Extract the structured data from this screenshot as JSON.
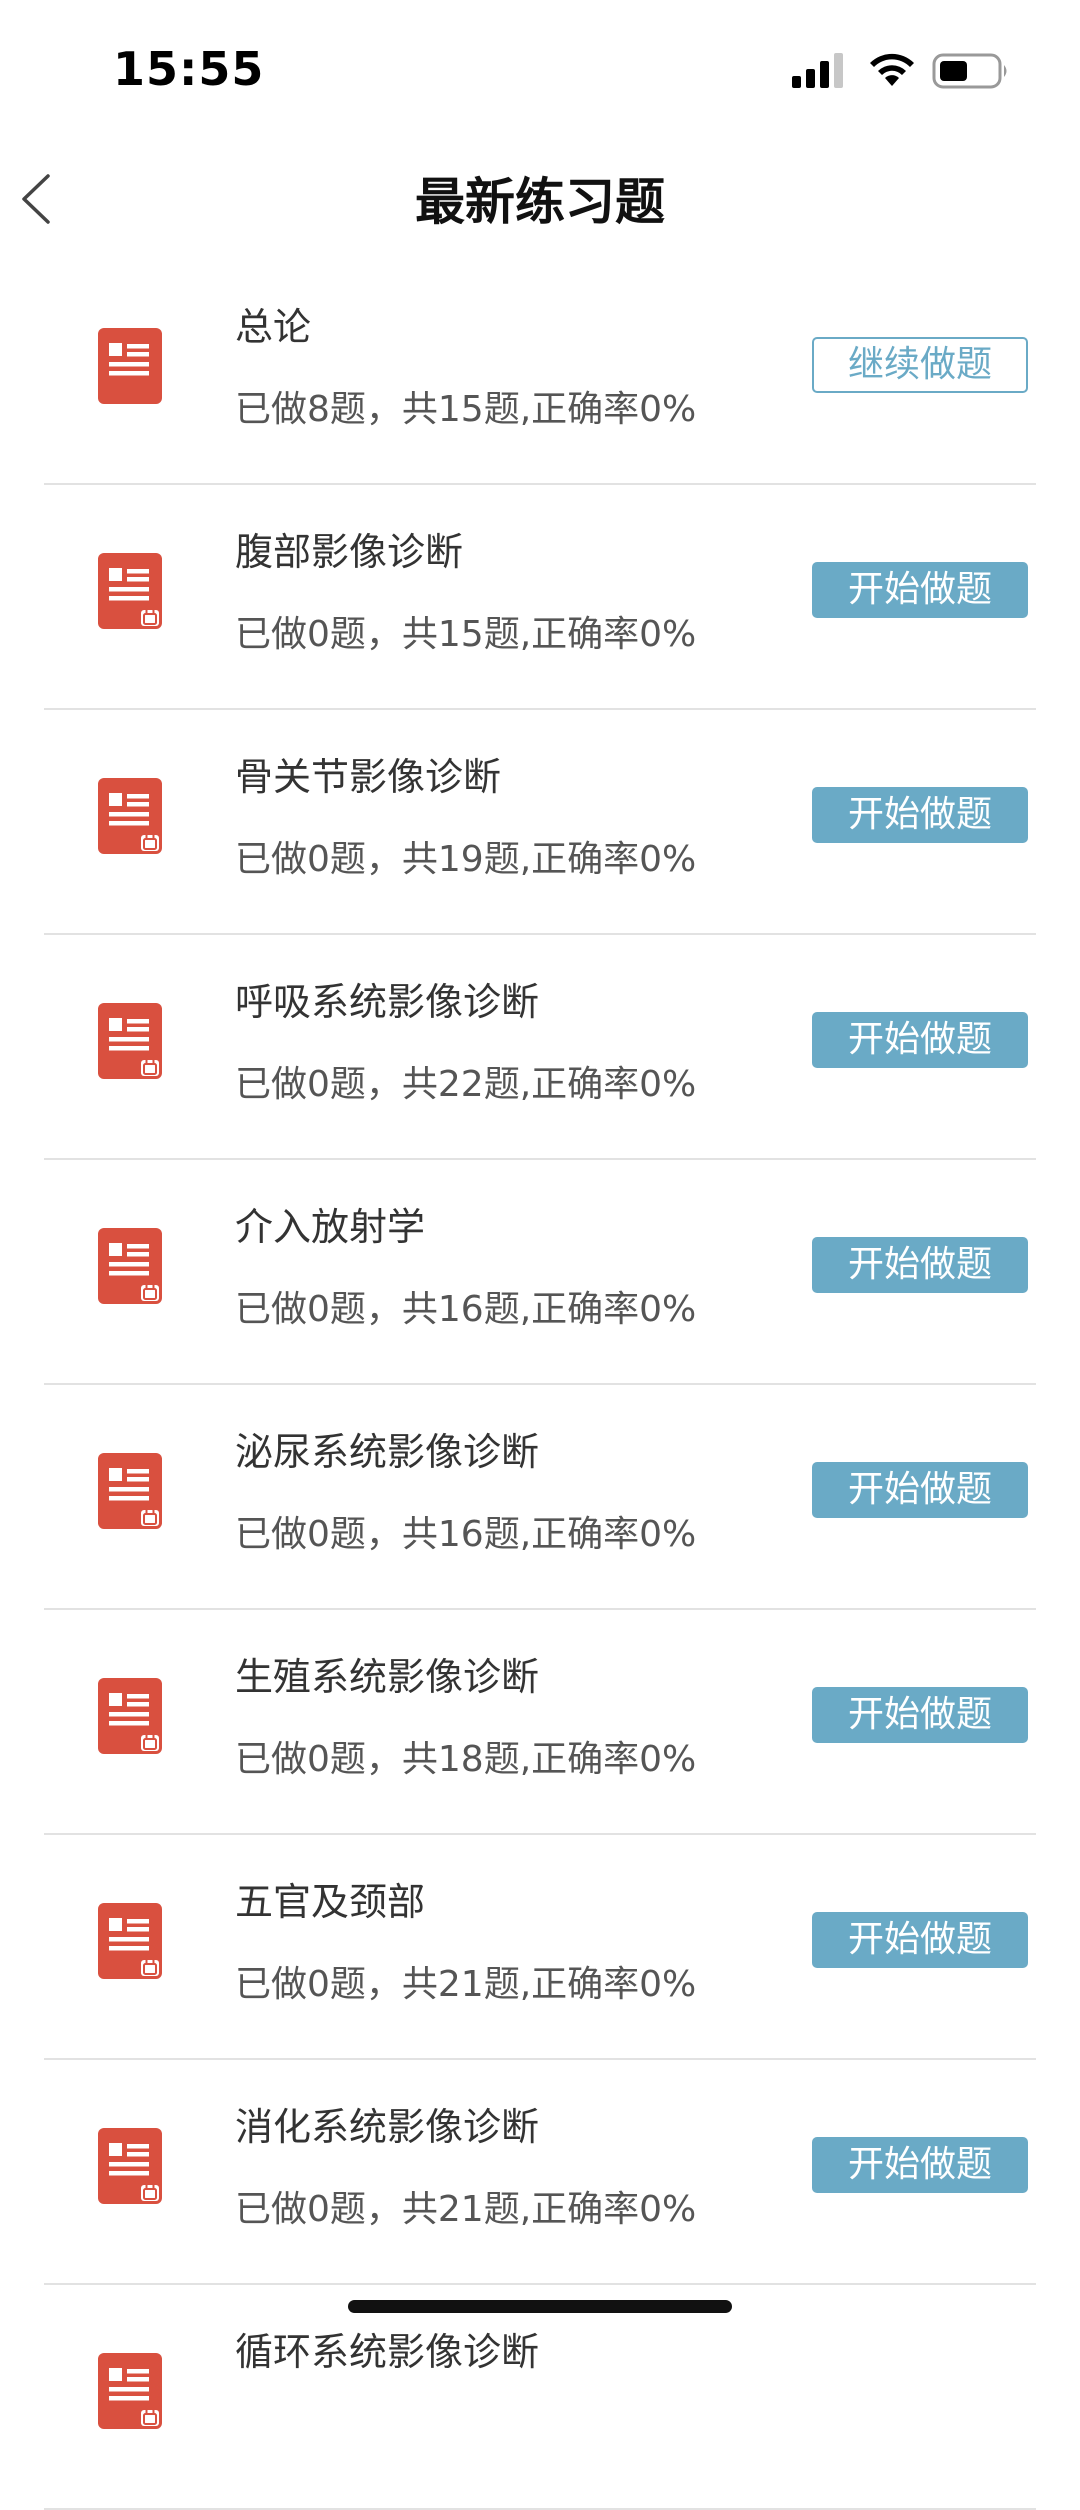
{
  "status_bar": {
    "time": "15:55"
  },
  "header": {
    "title": "最新练习题"
  },
  "colors": {
    "accent": "#6aaac6",
    "icon_red": "#d9503f"
  },
  "items": [
    {
      "title": "总论",
      "meta": "已做8题，共15题,正确率0%",
      "action": "继续做题",
      "action_style": "outline",
      "locked": false
    },
    {
      "title": "腹部影像诊断",
      "meta": "已做0题，共15题,正确率0%",
      "action": "开始做题",
      "action_style": "filled",
      "locked": true
    },
    {
      "title": "骨关节影像诊断",
      "meta": "已做0题，共19题,正确率0%",
      "action": "开始做题",
      "action_style": "filled",
      "locked": true
    },
    {
      "title": "呼吸系统影像诊断",
      "meta": "已做0题，共22题,正确率0%",
      "action": "开始做题",
      "action_style": "filled",
      "locked": true
    },
    {
      "title": "介入放射学",
      "meta": "已做0题，共16题,正确率0%",
      "action": "开始做题",
      "action_style": "filled",
      "locked": true
    },
    {
      "title": "泌尿系统影像诊断",
      "meta": "已做0题，共16题,正确率0%",
      "action": "开始做题",
      "action_style": "filled",
      "locked": true
    },
    {
      "title": "生殖系统影像诊断",
      "meta": "已做0题，共18题,正确率0%",
      "action": "开始做题",
      "action_style": "filled",
      "locked": true
    },
    {
      "title": "五官及颈部",
      "meta": "已做0题，共21题,正确率0%",
      "action": "开始做题",
      "action_style": "filled",
      "locked": true
    },
    {
      "title": "消化系统影像诊断",
      "meta": "已做0题，共21题,正确率0%",
      "action": "开始做题",
      "action_style": "filled",
      "locked": true
    },
    {
      "title": "循环系统影像诊断",
      "meta": "",
      "action": "",
      "action_style": "filled",
      "locked": true
    }
  ]
}
